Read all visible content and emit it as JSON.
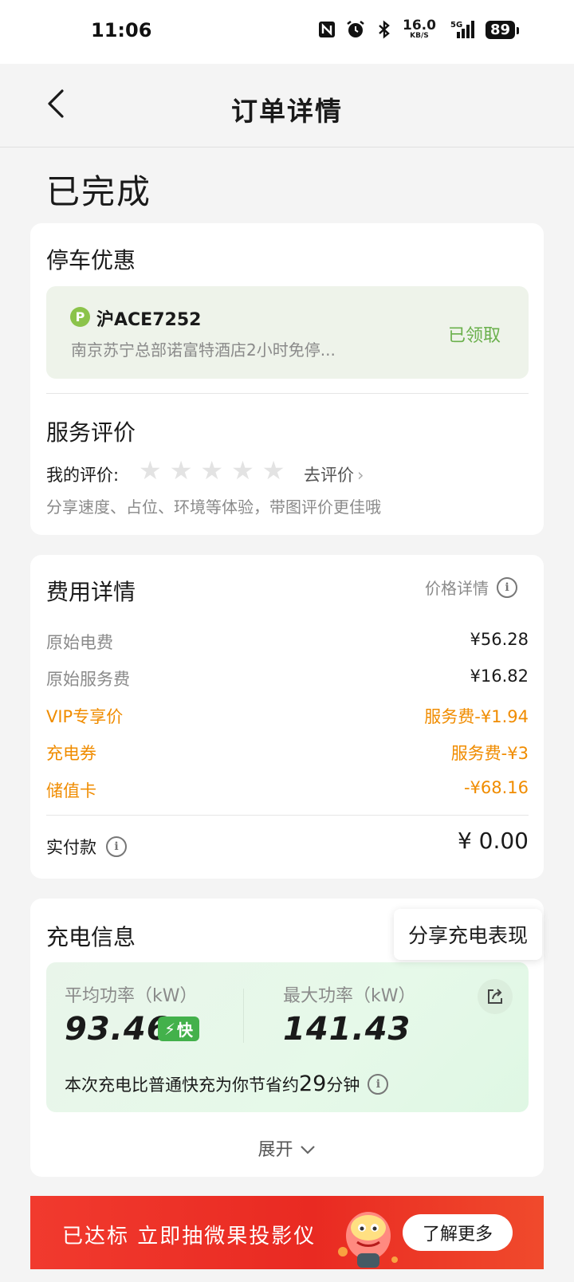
{
  "status_bar": {
    "time": "11:06",
    "speed_value": "16.0",
    "speed_unit": "KB/S",
    "network": "5G",
    "battery": "89"
  },
  "nav": {
    "title": "订单详情"
  },
  "order_status": "已完成",
  "parking": {
    "title": "停车优惠",
    "plate_badge": "P",
    "plate": "沪ACE7252",
    "description": "南京苏宁总部诺富特酒店2小时免停...",
    "status": "已领取"
  },
  "review": {
    "title": "服务评价",
    "my_rating_label": "我的评价:",
    "rating": 0,
    "max_rating": 5,
    "go_review": "去评价",
    "hint": "分享速度、占位、环境等体验，带图评价更佳哦"
  },
  "fees": {
    "title": "费用详情",
    "price_detail_link": "价格详情",
    "rows": [
      {
        "label": "原始电费",
        "value": "¥56.28"
      },
      {
        "label": "原始服务费",
        "value": "¥16.82"
      },
      {
        "label": "VIP专享价",
        "value": "服务费-¥1.94"
      },
      {
        "label": "充电券",
        "value": "服务费-¥3"
      },
      {
        "label": "储值卡",
        "value": "-¥68.16"
      }
    ],
    "paid_label": "实付款",
    "paid_value": "¥ 0.00"
  },
  "charging": {
    "title": "充电信息",
    "share_tooltip": "分享充电表现",
    "avg_power_label": "平均功率（kW）",
    "avg_power_value": "93.46",
    "fast_badge": "快",
    "max_power_label": "最大功率（kW）",
    "max_power_value": "141.43",
    "saving_prefix": "本次充电比普通快充为你节省约",
    "saving_minutes": "29",
    "saving_suffix": "分钟",
    "expand_label": "展开"
  },
  "banner": {
    "text": "已达标 立即抽微果投影仪",
    "button": "了解更多"
  },
  "colors": {
    "orange": "#f08c00",
    "green": "#6ab04c",
    "fast_green": "#43b14b",
    "banner_red": "#ef3a2b"
  }
}
